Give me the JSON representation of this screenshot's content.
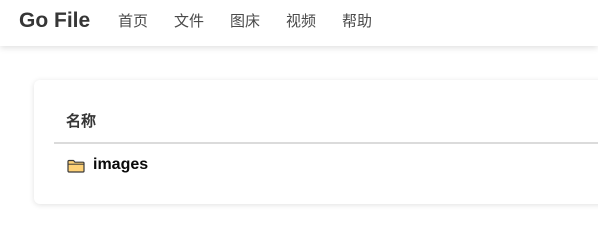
{
  "navbar": {
    "brand": "Go File",
    "items": [
      {
        "label": "首页"
      },
      {
        "label": "文件"
      },
      {
        "label": "图床"
      },
      {
        "label": "视频"
      },
      {
        "label": "帮助"
      }
    ]
  },
  "file_list": {
    "column_header": "名称",
    "rows": [
      {
        "name": "images",
        "type": "folder",
        "icon": "folder-icon"
      }
    ]
  },
  "colors": {
    "folder_fill": "#ffd277",
    "folder_stroke": "#3a3a3a",
    "divider": "#dbdbdb"
  }
}
